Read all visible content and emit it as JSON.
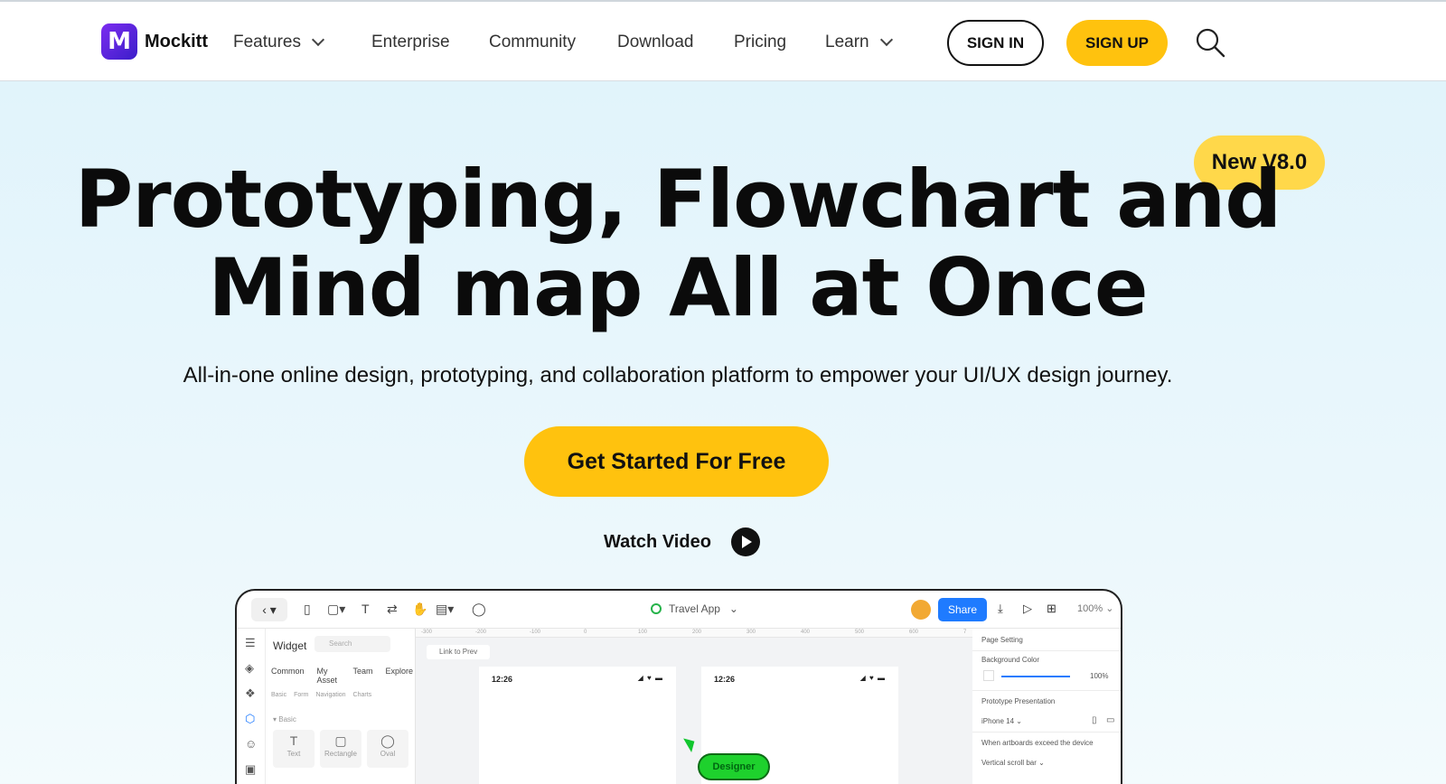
{
  "nav": {
    "logo_text": "Mockitt",
    "logo_letter": "M",
    "items": [
      {
        "label": "Features",
        "has_dropdown": true
      },
      {
        "label": "Enterprise",
        "has_dropdown": false
      },
      {
        "label": "Community",
        "has_dropdown": false
      },
      {
        "label": "Download",
        "has_dropdown": false
      },
      {
        "label": "Pricing",
        "has_dropdown": false
      },
      {
        "label": "Learn",
        "has_dropdown": true
      }
    ],
    "sign_in": "SIGN IN",
    "sign_up": "SIGN UP",
    "search_icon": "search-icon"
  },
  "hero": {
    "badge": "New V8.0",
    "title_line1": "Prototyping, Flowchart and",
    "title_line2": "Mind map All at Once",
    "subtitle": "All-in-one online design, prototyping, and collaboration platform to empower your UI/UX design journey.",
    "cta": "Get Started For Free",
    "watch_video": "Watch Video"
  },
  "app": {
    "file_name": "Travel App",
    "share_label": "Share",
    "zoom": "100%",
    "panel": {
      "title": "Widget",
      "search_placeholder": "Search",
      "tabs": [
        "Common",
        "My Asset",
        "Team",
        "Explore"
      ],
      "subtabs": [
        "Basic",
        "Form",
        "Navigation",
        "Charts"
      ],
      "section": "Basic",
      "widgets": [
        "Text",
        "Rectangle",
        "Oval"
      ]
    },
    "canvas": {
      "link_prev": "Link to Prev",
      "ruler_ticks": [
        "-300",
        "-200",
        "-100",
        "0",
        "100",
        "200",
        "300",
        "400",
        "500",
        "600",
        "7"
      ],
      "artboard_time": "12:26",
      "cursor_label": "Designer"
    },
    "props": {
      "page_setting": "Page Setting",
      "background_color": "Background Color",
      "opacity": "100%",
      "prototype_presentation": "Prototype Presentation",
      "device": "iPhone 14",
      "artboard_exceed": "When artboards exceed the device",
      "scroll_bar": "Vertical scroll bar"
    }
  },
  "colors": {
    "accent_yellow": "#ffc20e",
    "badge_yellow": "#ffd84a",
    "hero_bg": "#dff3fb",
    "share_blue": "#1f7bff",
    "cursor_green": "#1ed12d"
  }
}
